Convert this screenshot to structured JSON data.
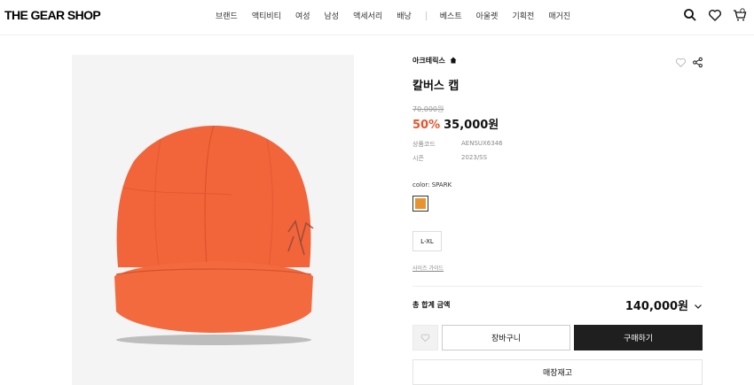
{
  "header": {
    "logo": "THE GEAR SHOP",
    "nav": [
      "브랜드",
      "액티비티",
      "여성",
      "남성",
      "액세서리",
      "배낭"
    ],
    "nav2": [
      "베스트",
      "아울렛",
      "기획전",
      "매거진"
    ]
  },
  "product": {
    "brand": "아크테릭스",
    "title": "칼버스 캡",
    "original_price": "70,000원",
    "discount": "50%",
    "price": "35,000원",
    "meta": [
      {
        "key": "상품코드",
        "value": "AENSUX6346"
      },
      {
        "key": "시즌",
        "value": "2023/SS"
      }
    ],
    "color_label": "color: SPARK",
    "swatch_color": "#e6952e",
    "size": "L-XL",
    "size_guide": "사이즈 가이드",
    "total_label": "총 합계 금액",
    "total_amount": "140,000원"
  },
  "actions": {
    "cart": "장바구니",
    "buy": "구매하기",
    "store": "매장재고"
  },
  "colors": {
    "accent": "#e8552d",
    "cap": "#f2643a"
  }
}
